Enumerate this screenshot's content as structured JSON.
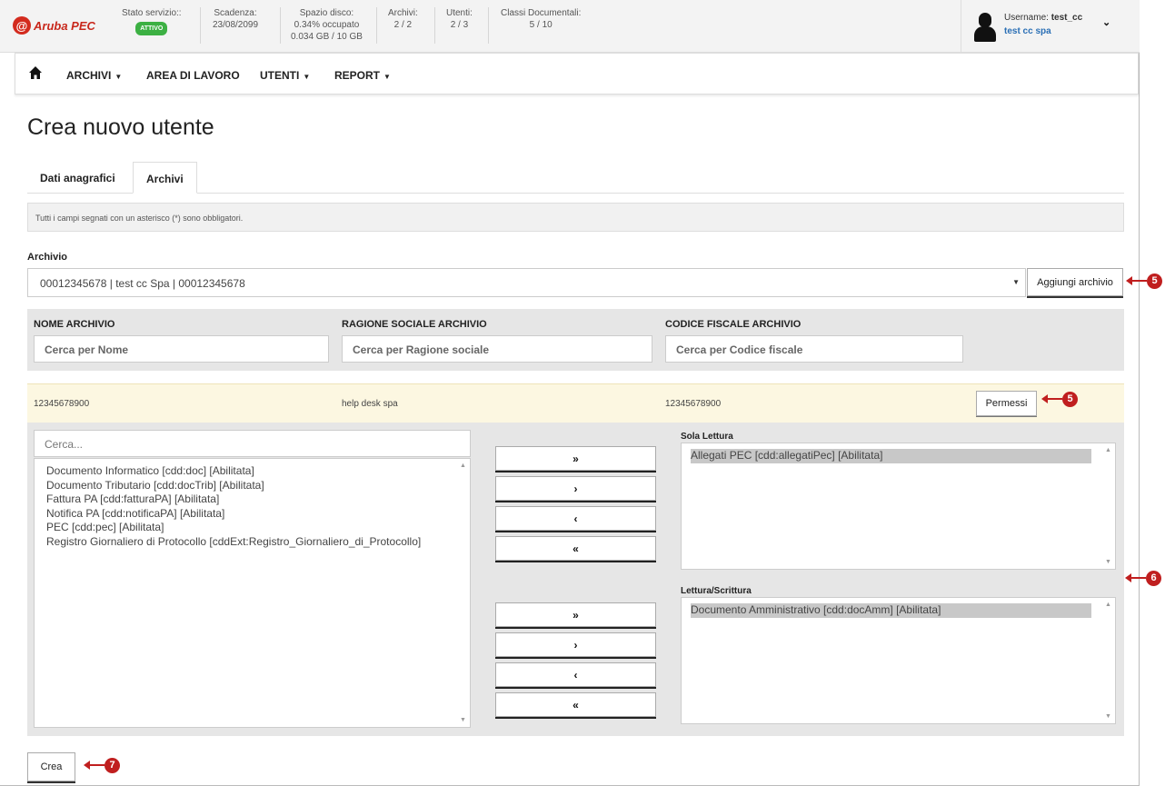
{
  "brand": {
    "mark": "@",
    "name": "Aruba PEC"
  },
  "status": {
    "service": {
      "label": "Stato servizio::",
      "badge": "ATTIVO"
    },
    "expiry": {
      "label": "Scadenza:",
      "value": "23/08/2099"
    },
    "disk": {
      "label": "Spazio disco:",
      "percent": "0.34% occupato",
      "usage": "0.034 GB / 10 GB"
    },
    "archives": {
      "label": "Archivi:",
      "value": "2 / 2"
    },
    "users": {
      "label": "Utenti:",
      "value": "2 / 3"
    },
    "doc_classes": {
      "label": "Classi Documentali:",
      "value": "5 / 10"
    }
  },
  "user": {
    "username_label": "Username:",
    "username": "test_cc",
    "company": "test cc spa"
  },
  "nav": {
    "archivi": "ARCHIVI",
    "area": "AREA DI LAVORO",
    "utenti": "UTENTI",
    "report": "REPORT"
  },
  "page_title": "Crea nuovo utente",
  "tabs": {
    "dati": "Dati anagrafici",
    "archivi": "Archivi"
  },
  "info_text": "Tutti i campi segnati con un asterisco (*) sono obbligatori.",
  "archive": {
    "label": "Archivio",
    "selected": "00012345678 | test cc Spa | 00012345678",
    "add_button": "Aggiungi archivio"
  },
  "filters": {
    "name": {
      "label": "NOME ARCHIVIO",
      "placeholder": "Cerca per Nome"
    },
    "company": {
      "label": "RAGIONE SOCIALE ARCHIVIO",
      "placeholder": "Cerca per Ragione sociale"
    },
    "fiscal": {
      "label": "CODICE FISCALE ARCHIVIO",
      "placeholder": "Cerca per Codice fiscale"
    }
  },
  "archive_row": {
    "name": "12345678900",
    "company": "help desk spa",
    "fiscal": "12345678900",
    "button": "Permessi"
  },
  "permissions": {
    "search_placeholder": "Cerca...",
    "available": [
      "Documento Informatico [cdd:doc] [Abilitata]",
      "Documento Tributario [cdd:docTrib] [Abilitata]",
      "Fattura PA [cdd:fatturaPA] [Abilitata]",
      "Notifica PA [cdd:notificaPA] [Abilitata]",
      "PEC [cdd:pec] [Abilitata]",
      "Registro Giornaliero di Protocollo [cddExt:Registro_Giornaliero_di_Protocollo]"
    ],
    "read_only_label": "Sola Lettura",
    "read_only": [
      "Allegati PEC [cdd:allegatiPec] [Abilitata]"
    ],
    "read_write_label": "Lettura/Scrittura",
    "read_write": [
      "Documento Amministrativo [cdd:docAmm] [Abilitata]"
    ],
    "move_icons": [
      "»",
      "›",
      "‹",
      "«"
    ]
  },
  "create_button": "Crea",
  "markers": {
    "m5": "5",
    "m6": "6",
    "m7": "7"
  },
  "colors": {
    "brand": "#d32b1e",
    "badge": "#3cb043",
    "marker": "#c01f1f",
    "row_highlight": "#fcf7e1"
  }
}
